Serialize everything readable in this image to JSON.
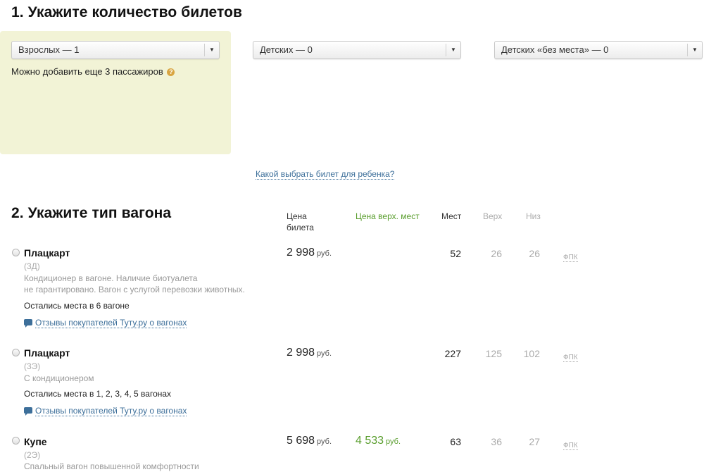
{
  "section1": {
    "title": "1. Укажите количество билетов",
    "adults_select": "Взрослых — 1",
    "children_select": "Детских — 0",
    "infants_select": "Детских «без места» — 0",
    "hint": "Можно добавить еще 3 пассажиров",
    "help_icon": "question-icon",
    "child_ticket_link": "Какой выбрать билет для ребенка?"
  },
  "section2": {
    "title": "2. Укажите тип вагона",
    "columns": {
      "price_line1": "Цена",
      "price_line2": "билета",
      "upper_price": "Цена верх. мест",
      "seats": "Мест",
      "upper": "Верх",
      "lower": "Низ"
    },
    "cars": [
      {
        "name": "Плацкарт",
        "code": "(3Д)",
        "desc_line1": "Кондиционер в вагоне. Наличие биотуалета",
        "desc_line2": "не гарантировано. Вагон с услугой перевозки животных.",
        "availability": "Остались места в 6 вагоне",
        "reviews": "Отзывы покупателей Туту.ру о вагонах",
        "price": "2 998",
        "currency": "руб.",
        "upper_price": "",
        "seats": "52",
        "upper": "26",
        "lower": "26",
        "carrier": "ФПК"
      },
      {
        "name": "Плацкарт",
        "code": "(3Э)",
        "desc_line1": "С кондиционером",
        "desc_line2": "",
        "availability": "Остались места в 1, 2, 3, 4, 5 вагонах",
        "reviews": "Отзывы покупателей Туту.ру о вагонах",
        "price": "2 998",
        "currency": "руб.",
        "upper_price": "",
        "seats": "227",
        "upper": "125",
        "lower": "102",
        "carrier": "ФПК"
      },
      {
        "name": "Купе",
        "code": "(2Э)",
        "desc_line1": "Спальный вагон повышенной комфортности",
        "desc_line2": "",
        "availability": "",
        "reviews": "",
        "price": "5 698",
        "currency": "руб.",
        "upper_price": "4 533",
        "upper_currency": "руб.",
        "seats": "63",
        "upper": "36",
        "lower": "27",
        "carrier": "ФПК"
      }
    ]
  },
  "colors": {
    "panel_bg": "#f2f3d6",
    "link": "#3d6f9a",
    "green": "#5a9e2e",
    "muted": "#aaaaaa"
  }
}
